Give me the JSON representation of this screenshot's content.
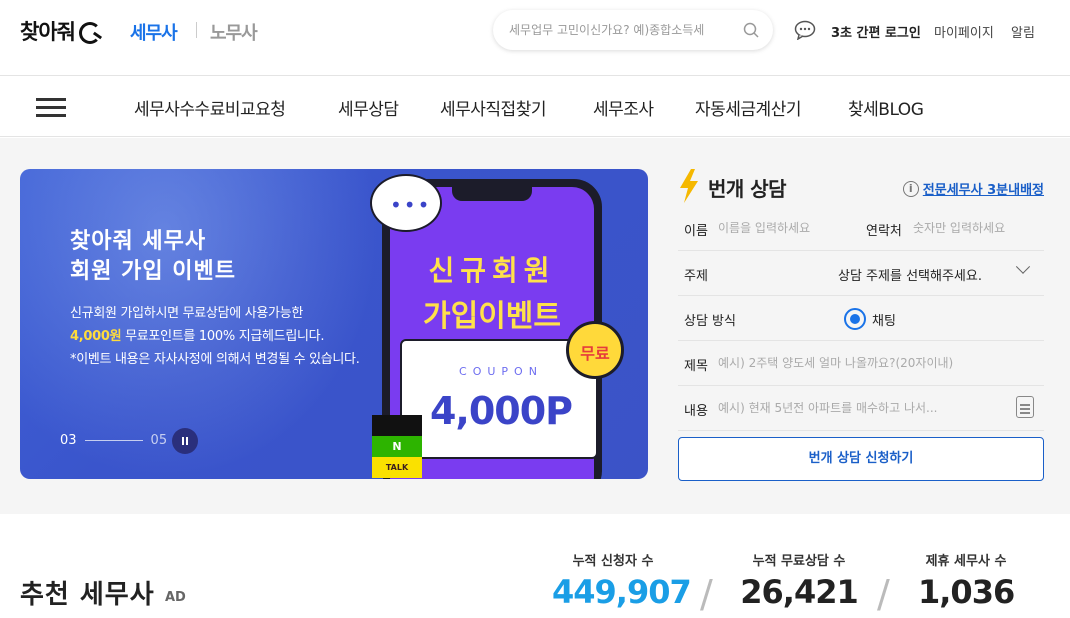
{
  "header": {
    "logo_text": "찾아줘",
    "service_active": "세무사",
    "service_other": "노무사",
    "search": {
      "placeholder": "세무업무 고민이신가요? 예)종합소득세"
    },
    "links": {
      "quick_login": "3초 간편 로그인",
      "mypage": "마이페이지",
      "alarm": "알림"
    }
  },
  "nav": {
    "items": [
      "세무사수수료비교요청",
      "세무상담",
      "세무사직접찾기",
      "세무조사",
      "자동세금계산기",
      "찾세BLOG"
    ]
  },
  "banner": {
    "title_line1": "찾아줘 세무사",
    "title_line2": "회원 가입 이벤트",
    "desc_line1": "신규회원 가입하시면 무료상담에 사용가능한",
    "desc_highlight": "4,000원",
    "desc_line2_rest": " 무료포인트를 100% 지급헤드립니다.",
    "desc_line3": "*이벤트 내용은 자사사정에 의해서 변경될 수 있습니다.",
    "slide_current": "03",
    "slide_total": "05",
    "phone_head1": "신규회원",
    "phone_head2": "가입이벤트",
    "coupon_label": "COUPON",
    "coupon_value": "4,000P",
    "free_badge": "무료",
    "app_n": "N",
    "app_talk": "TALK"
  },
  "consult": {
    "title": "번개 상담",
    "info_link": "전문세무사 3분내배정",
    "name_label": "이름",
    "name_placeholder": "이름을 입력하세요",
    "phone_label": "연락처",
    "phone_placeholder": "숫자만 입력하세요",
    "topic_label": "주제",
    "topic_value": "상담 주제를 선택해주세요.",
    "method_label": "상담 방식",
    "method_value": "채팅",
    "subject_label": "제목",
    "subject_placeholder": "예시) 2주택 양도세 얼마 나올까요?(20자이내)",
    "content_label": "내용",
    "content_placeholder": "예시) 현재 5년전 아파트를 매수하고 나서...",
    "submit_label": "번개 상담 신청하기"
  },
  "bottom": {
    "rec_title": "추천 세무사",
    "rec_ad": "AD",
    "stats": [
      {
        "label": "누적 신청자 수",
        "value": "449,907"
      },
      {
        "label": "누적 무료상담 수",
        "value": "26,421"
      },
      {
        "label": "제휴 세무사 수",
        "value": "1,036"
      }
    ],
    "separator": "/"
  },
  "colors": {
    "accent_blue": "#1a73e8",
    "banner_bg": "#3b53c7",
    "stat_blue": "#1a9ee6",
    "highlight_yellow": "#ffdc3c"
  }
}
